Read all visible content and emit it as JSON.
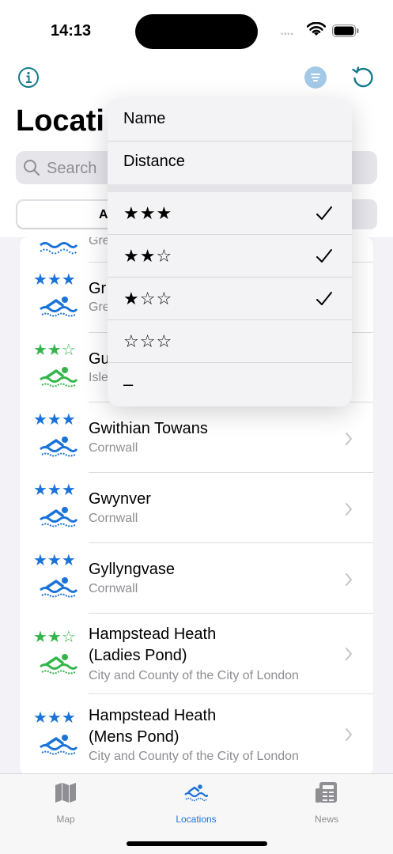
{
  "status_bar": {
    "time": "14:13",
    "dots": "••••"
  },
  "header": {
    "title": "Locati",
    "search_placeholder": "Search",
    "segment_selected": "A"
  },
  "colors": {
    "accent": "#1a73d9",
    "blue_star": "#1a73d9",
    "green_star": "#34b54c",
    "teal_icon": "#157a8c",
    "sort_button": "#a3c9e6"
  },
  "list": {
    "rows": [
      {
        "stars": "",
        "region": "Gre",
        "icon_color": "#1a73d9",
        "name": ""
      },
      {
        "stars": "★★★",
        "star_color": "#1a73d9",
        "name": "Gr",
        "region": "Gre",
        "icon_color": "#1a73d9"
      },
      {
        "stars": "★★☆",
        "star_color": "#34b54c",
        "name": "Gu",
        "region": "Isle",
        "icon_color": "#34b54c"
      },
      {
        "stars": "★★★",
        "star_color": "#1a73d9",
        "name": "Gwithian Towans",
        "region": "Cornwall",
        "icon_color": "#1a73d9"
      },
      {
        "stars": "★★★",
        "star_color": "#1a73d9",
        "name": "Gwynver",
        "region": "Cornwall",
        "icon_color": "#1a73d9"
      },
      {
        "stars": "★★★",
        "star_color": "#1a73d9",
        "name": "Gyllyngvase",
        "region": "Cornwall",
        "icon_color": "#1a73d9"
      },
      {
        "stars": "★★☆",
        "star_color": "#34b54c",
        "name_line1": "Hampstead Heath",
        "name_line2": "(Ladies Pond)",
        "region": "City and County of the City of London",
        "icon_color": "#34b54c"
      },
      {
        "stars": "★★★",
        "star_color": "#1a73d9",
        "name_line1": "Hampstead Heath",
        "name_line2": "(Mens Pond)",
        "region": "City and County of the City of London",
        "icon_color": "#1a73d9"
      }
    ]
  },
  "menu": {
    "sort_items": [
      {
        "label": "Name"
      },
      {
        "label": "Distance"
      }
    ],
    "filter_items": [
      {
        "stars": "★★★",
        "checked": true
      },
      {
        "stars": "★★☆",
        "checked": true
      },
      {
        "stars": "★☆☆",
        "checked": true
      },
      {
        "stars": "☆☆☆",
        "checked": false
      },
      {
        "stars": "–",
        "checked": false
      }
    ]
  },
  "tabbar": {
    "tabs": [
      {
        "label": "Map",
        "icon": "map-icon",
        "active": false
      },
      {
        "label": "Locations",
        "icon": "swimmer-icon",
        "active": true
      },
      {
        "label": "News",
        "icon": "newspaper-icon",
        "active": false
      }
    ]
  }
}
